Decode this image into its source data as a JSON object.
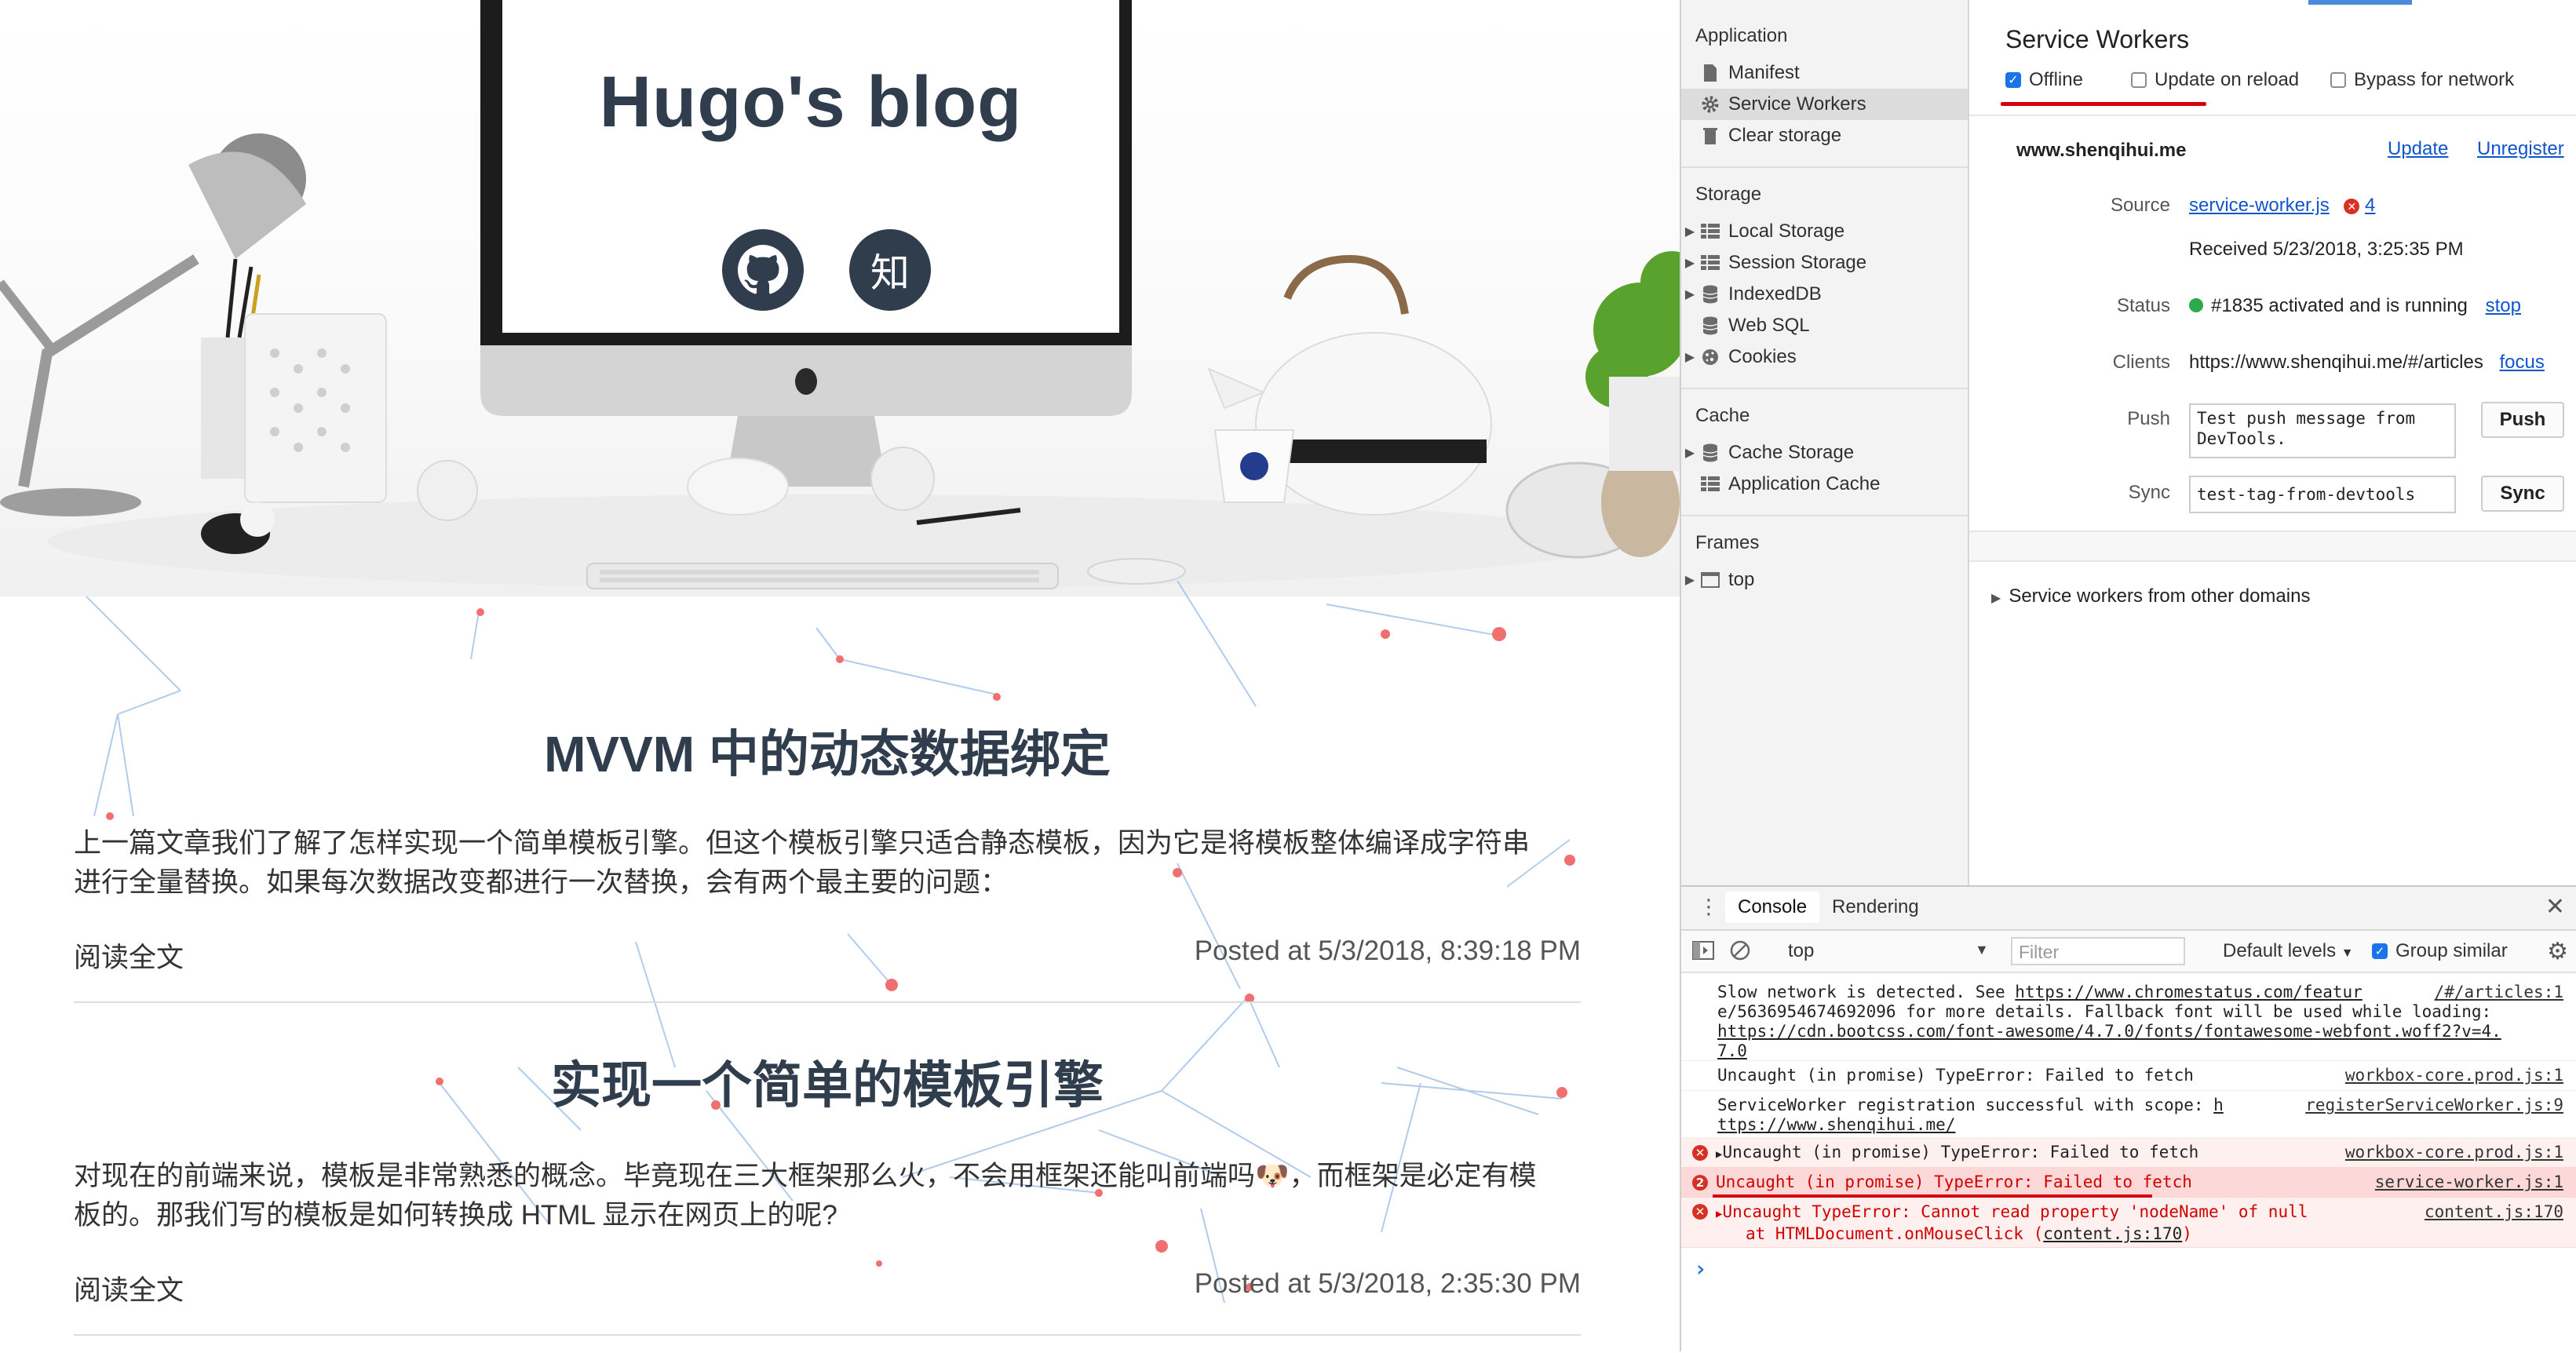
{
  "blog": {
    "title": "Hugo's blog",
    "social": {
      "github_icon": "github-icon",
      "zhihu_label": "知"
    },
    "articles": [
      {
        "title": "MVVM 中的动态数据绑定",
        "excerpt_line1": "上一篇文章我们了解了怎样实现一个简单模板引擎。但这个模板引擎只适合静态模板，因为它是将模板整体编译成字符串",
        "excerpt_line2": "进行全量替换。如果每次数据改变都进行一次替换，会有两个最主要的问题：",
        "read_more": "阅读全文",
        "posted": "Posted at 5/3/2018, 8:39:18 PM"
      },
      {
        "title": "实现一个简单的模板引擎",
        "excerpt_line1": "对现在的前端来说，模板是非常熟悉的概念。毕竟现在三大框架那么火，不会用框架还能叫前端吗🐶，而框架是必定有模",
        "excerpt_line2": "板的。那我们写的模板是如何转换成 HTML 显示在网页上的呢?",
        "read_more": "阅读全文",
        "posted": "Posted at 5/3/2018, 2:35:30 PM"
      }
    ]
  },
  "devtools": {
    "sidebar": {
      "application_header": "Application",
      "application_items": [
        "Manifest",
        "Service Workers",
        "Clear storage"
      ],
      "storage_header": "Storage",
      "storage_items": [
        "Local Storage",
        "Session Storage",
        "IndexedDB",
        "Web SQL",
        "Cookies"
      ],
      "cache_header": "Cache",
      "cache_items": [
        "Cache Storage",
        "Application Cache"
      ],
      "frames_header": "Frames",
      "frames_items": [
        "top"
      ]
    },
    "service_workers": {
      "title": "Service Workers",
      "offline_label": "Offline",
      "offline_checked": true,
      "update_on_reload_label": "Update on reload",
      "bypass_label": "Bypass for network",
      "domain": "www.shenqihui.me",
      "update_link": "Update",
      "unregister_link": "Unregister",
      "source_label": "Source",
      "source_file": "service-worker.js",
      "source_error_count": "4",
      "received": "Received 5/23/2018, 3:25:35 PM",
      "status_label": "Status",
      "status_text": "#1835 activated and is running",
      "stop_link": "stop",
      "status_color": "#2eaa4a",
      "clients_label": "Clients",
      "clients_url": "https://www.shenqihui.me/#/articles",
      "focus_link": "focus",
      "push_label": "Push",
      "push_line1": "Test push message from",
      "push_line2": "DevTools.",
      "push_button": "Push",
      "sync_label": "Sync",
      "sync_value": "test-tag-from-devtools",
      "sync_button": "Sync",
      "other_domains": "Service workers from other domains"
    },
    "drawer": {
      "tabs": [
        "Console",
        "Rendering"
      ],
      "context": "top",
      "filter_placeholder": "Filter",
      "levels": "Default levels",
      "group_similar": "Group similar",
      "messages": [
        {
          "lines": [
            "Slow network is detected. See ",
            "e/5636954674692096 for more details. Fallback font will be used while loading:",
            "https://cdn.bootcss.com/font-awesome/4.7.0/fonts/fontawesome-webfont.woff2?v=4.",
            "7.0"
          ],
          "link1": "https://www.chromestatus.com/featur",
          "src": "/#/articles:1"
        },
        {
          "text": "Uncaught (in promise) TypeError: Failed to fetch",
          "src": "workbox-core.prod.js:1"
        },
        {
          "line1": "ServiceWorker registration successful with scope: ",
          "line1_link": "h",
          "line2": "ttps://www.shenqihui.me/",
          "src": "registerServiceWorker.js:9"
        },
        {
          "text": "Uncaught (in promise) TypeError: Failed to fetch",
          "src": "workbox-core.prod.js:1"
        },
        {
          "count": "2",
          "text": "Uncaught (in promise) TypeError: Failed to fetch",
          "src": "service-worker.js:1"
        },
        {
          "line1": "Uncaught TypeError: Cannot read property 'nodeName' of null",
          "line2": "at HTMLDocument.onMouseClick (",
          "line2_link": "content.js:170",
          "line2_end": ")",
          "src": "content.js:170"
        }
      ],
      "prompt": "›"
    },
    "colors": {
      "accent": "#1a73e8",
      "error": "#d00000",
      "error_bg": "#fff0f0",
      "underline": "#d8000c"
    }
  }
}
